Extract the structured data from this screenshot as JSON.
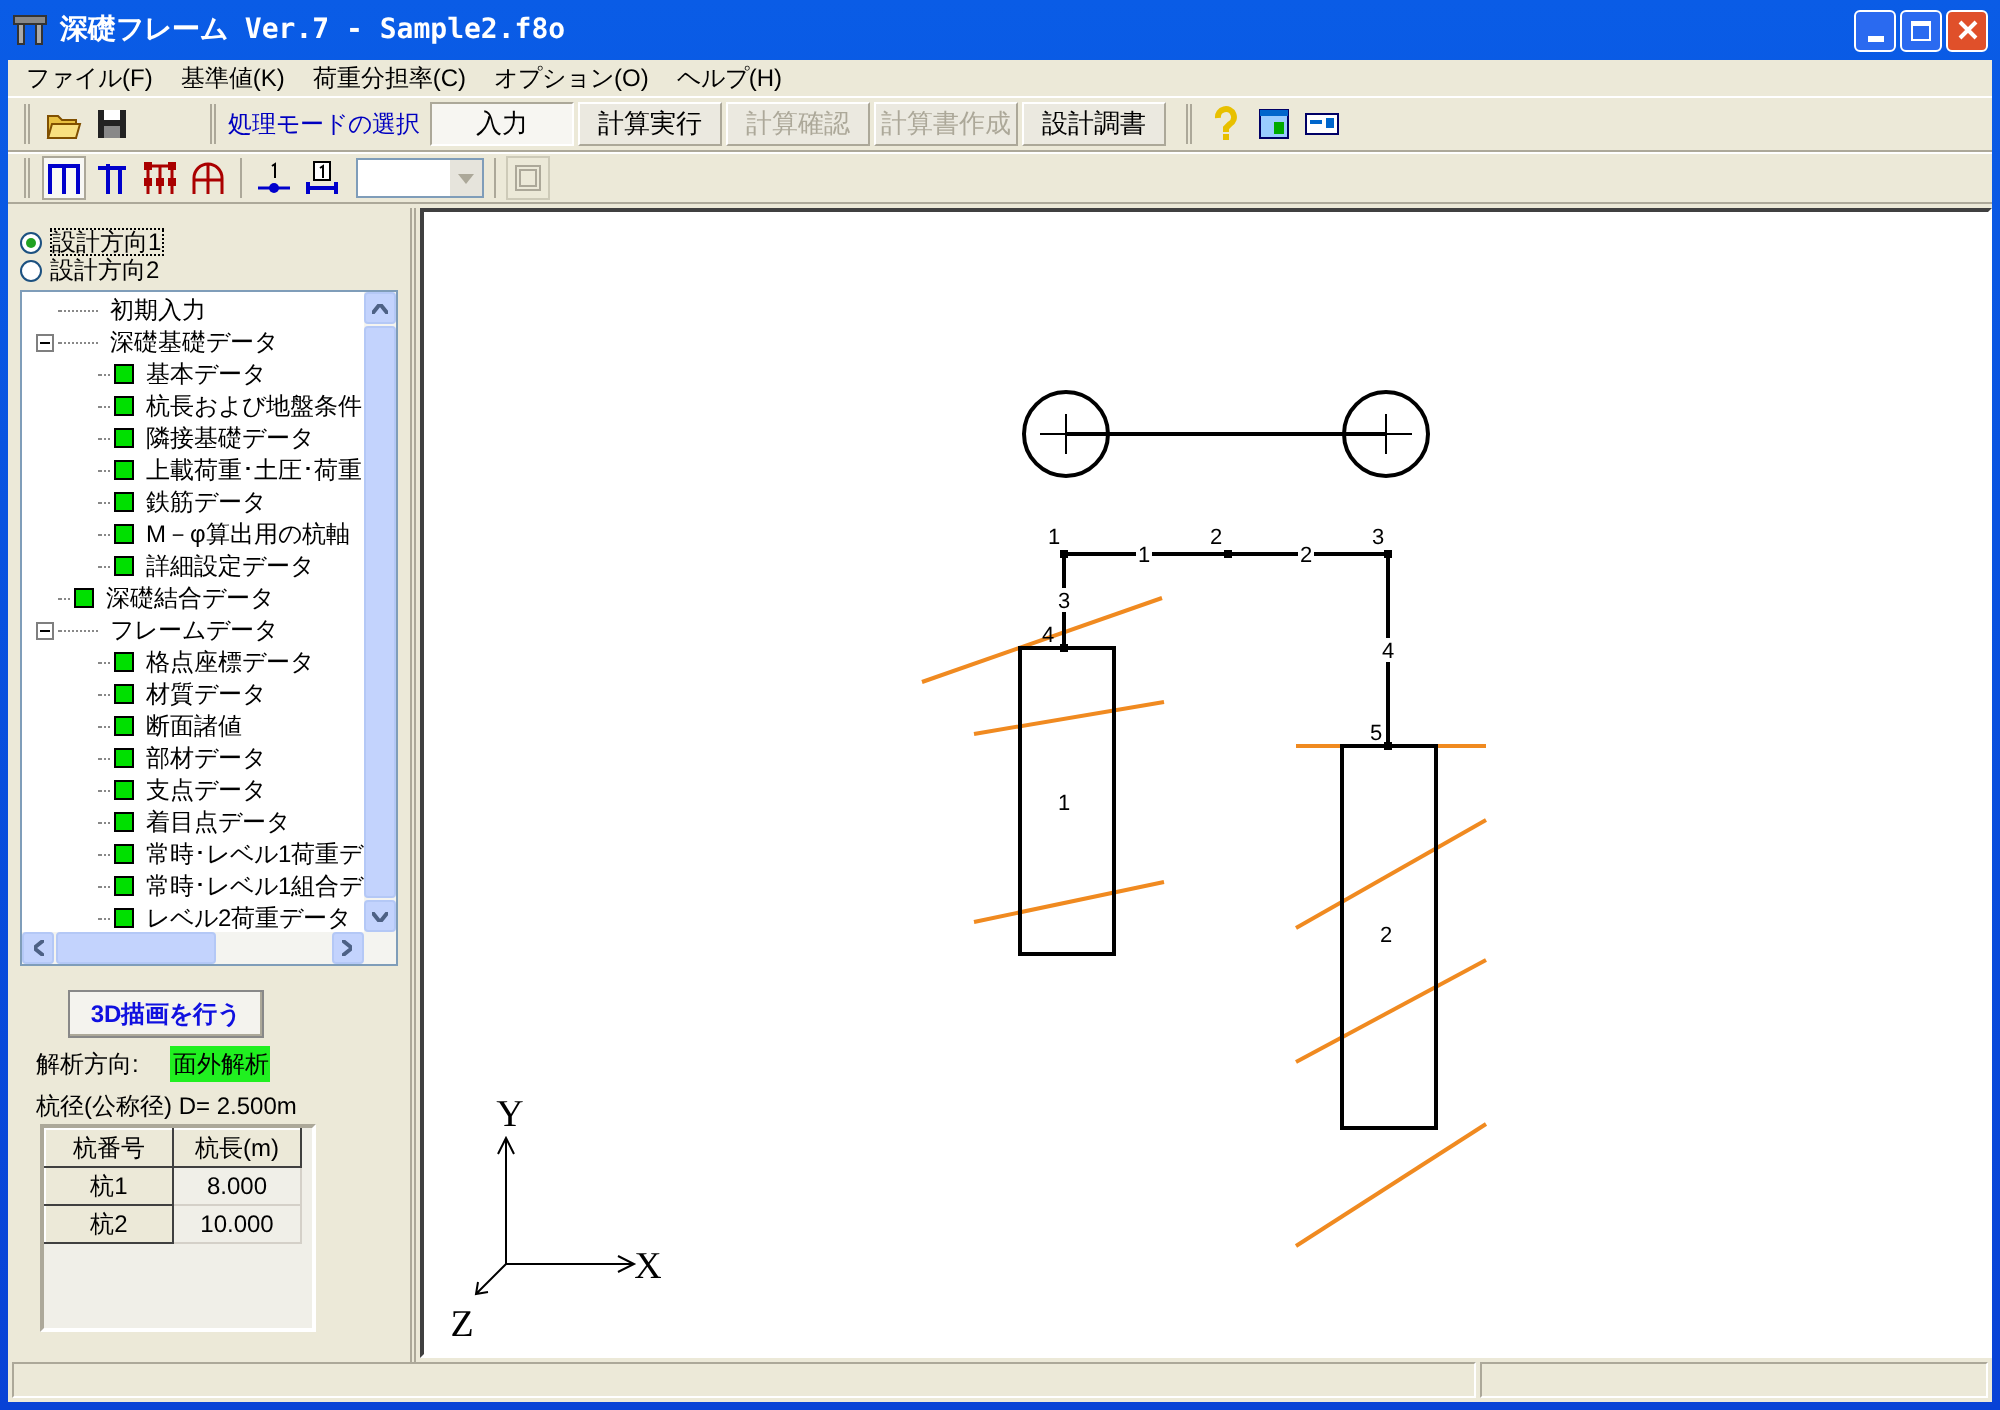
{
  "window": {
    "title": "深礎フレーム Ver.7 - Sample2.f8o"
  },
  "menu": [
    "ファイル(F)",
    "基準値(K)",
    "荷重分担率(C)",
    "オプション(O)",
    "ヘルプ(H)"
  ],
  "toolbar": {
    "mode_label": "処理モードの選択",
    "buttons": [
      {
        "label": "入力",
        "selected": true,
        "disabled": false
      },
      {
        "label": "計算実行",
        "selected": false,
        "disabled": false
      },
      {
        "label": "計算確認",
        "selected": false,
        "disabled": true
      },
      {
        "label": "計算書作成",
        "selected": false,
        "disabled": true
      },
      {
        "label": "設計調書",
        "selected": false,
        "disabled": false
      }
    ]
  },
  "directions": [
    {
      "label": "設計方向1",
      "selected": true
    },
    {
      "label": "設計方向2",
      "selected": false
    }
  ],
  "tree": [
    {
      "label": "初期入力",
      "complete": false
    },
    {
      "label": "深礎基礎データ",
      "complete": false,
      "expanded": true,
      "children": [
        {
          "label": "基本データ",
          "complete": true
        },
        {
          "label": "杭長および地盤条件",
          "complete": true
        },
        {
          "label": "隣接基礎データ",
          "complete": true
        },
        {
          "label": "上載荷重･土圧･荷重",
          "complete": true
        },
        {
          "label": "鉄筋データ",
          "complete": true
        },
        {
          "label": "M－φ算出用の杭軸",
          "complete": true
        },
        {
          "label": "詳細設定データ",
          "complete": true
        }
      ]
    },
    {
      "label": "深礎結合データ",
      "complete": true
    },
    {
      "label": "フレームデータ",
      "complete": false,
      "expanded": true,
      "children": [
        {
          "label": "格点座標データ",
          "complete": true
        },
        {
          "label": "材質データ",
          "complete": true
        },
        {
          "label": "断面諸値",
          "complete": true
        },
        {
          "label": "部材データ",
          "complete": true
        },
        {
          "label": "支点データ",
          "complete": true
        },
        {
          "label": "着目点データ",
          "complete": true
        },
        {
          "label": "常時･レベル1荷重デ",
          "complete": true
        },
        {
          "label": "常時･レベル1組合デ",
          "complete": true
        },
        {
          "label": "レベル2荷重データ",
          "complete": true
        }
      ]
    }
  ],
  "draw3d_button": "3D描画を行う",
  "analysis": {
    "label": "解析方向:",
    "value": "面外解析"
  },
  "diameter": "杭径(公称径) D= 2.500m",
  "pile_table": {
    "columns": [
      "杭番号",
      "杭長(m)"
    ],
    "rows": [
      [
        "杭1",
        "8.000"
      ],
      [
        "杭2",
        "10.000"
      ]
    ]
  },
  "canvas": {
    "node_labels": [
      "1",
      "2",
      "3",
      "4",
      "5"
    ],
    "member_labels": [
      "1",
      "2",
      "3",
      "4"
    ],
    "pile_labels": [
      "1",
      "2"
    ],
    "axis_labels": [
      "X",
      "Y",
      "Z"
    ]
  }
}
